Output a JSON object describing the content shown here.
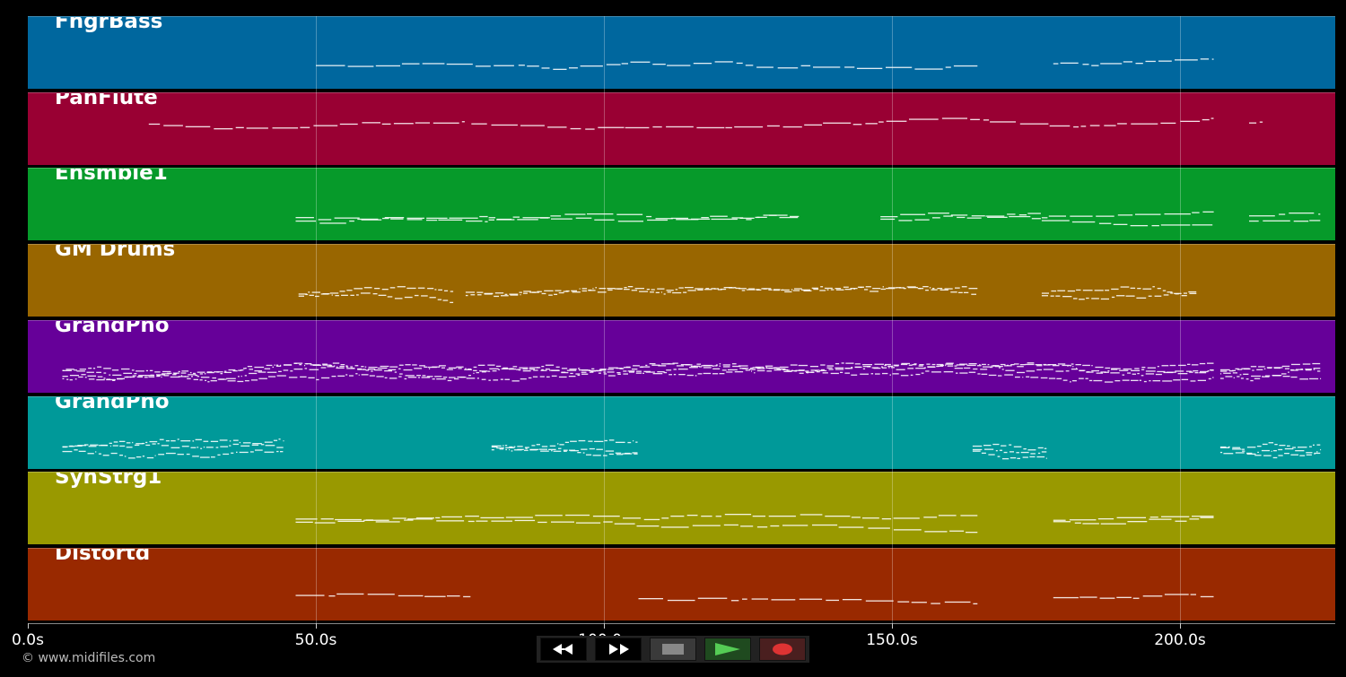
{
  "app": {
    "copyright": "© www.midifiles.com"
  },
  "timeline": {
    "max_seconds": 227,
    "ticks": [
      {
        "value": 0,
        "label": "0.0s"
      },
      {
        "value": 50,
        "label": "50.0s"
      },
      {
        "value": 100,
        "label": "100.0s"
      },
      {
        "value": 150,
        "label": "150.0s"
      },
      {
        "value": 200,
        "label": "200.0s"
      }
    ]
  },
  "tracks": [
    {
      "name": "FngrBass",
      "color": "#00679e",
      "segments": [
        [
          50,
          165
        ],
        [
          178,
          206
        ]
      ],
      "density": 0.45,
      "layers": 1
    },
    {
      "name": "PanFlute",
      "color": "#990033",
      "segments": [
        [
          21,
          76
        ],
        [
          77,
          167
        ],
        [
          167,
          206
        ],
        [
          212,
          214.5
        ]
      ],
      "density": 0.6,
      "layers": 1
    },
    {
      "name": "Ensmble1",
      "color": "#069a2a",
      "segments": [
        [
          46.5,
          80
        ],
        [
          80,
          134
        ],
        [
          148,
          176
        ],
        [
          176,
          206
        ],
        [
          212,
          224.5
        ]
      ],
      "density": 0.5,
      "layers": 2
    },
    {
      "name": "GM Drums",
      "color": "#996600",
      "segments": [
        [
          47,
          74
        ],
        [
          76,
          165
        ],
        [
          176,
          203
        ]
      ],
      "density": 1.0,
      "layers": 2
    },
    {
      "name": "GrandPno",
      "color": "#660099",
      "segments": [
        [
          6,
          206
        ],
        [
          207,
          224.5
        ]
      ],
      "density": 1.0,
      "layers": 4
    },
    {
      "name": "GrandPno",
      "color": "#009999",
      "segments": [
        [
          6,
          44.5
        ],
        [
          80.5,
          106
        ],
        [
          164,
          177
        ],
        [
          207,
          224.5
        ]
      ],
      "density": 1.0,
      "layers": 3
    },
    {
      "name": "SynStrg1",
      "color": "#999900",
      "segments": [
        [
          46.5,
          165
        ],
        [
          178,
          206
        ]
      ],
      "density": 0.7,
      "layers": 2
    },
    {
      "name": "Distortd",
      "color": "#992900",
      "segments": [
        [
          46.5,
          77
        ],
        [
          106,
          165
        ],
        [
          178,
          206
        ]
      ],
      "density": 0.4,
      "layers": 1
    }
  ],
  "transport": {
    "rewind_icon": "rewind-icon",
    "fast_forward_icon": "fast-forward-icon",
    "stop_icon": "stop-icon",
    "play_icon": "play-icon",
    "record_icon": "record-icon",
    "colors": {
      "stop": "#888888",
      "play": "#55cc55",
      "record": "#dd3333"
    }
  }
}
